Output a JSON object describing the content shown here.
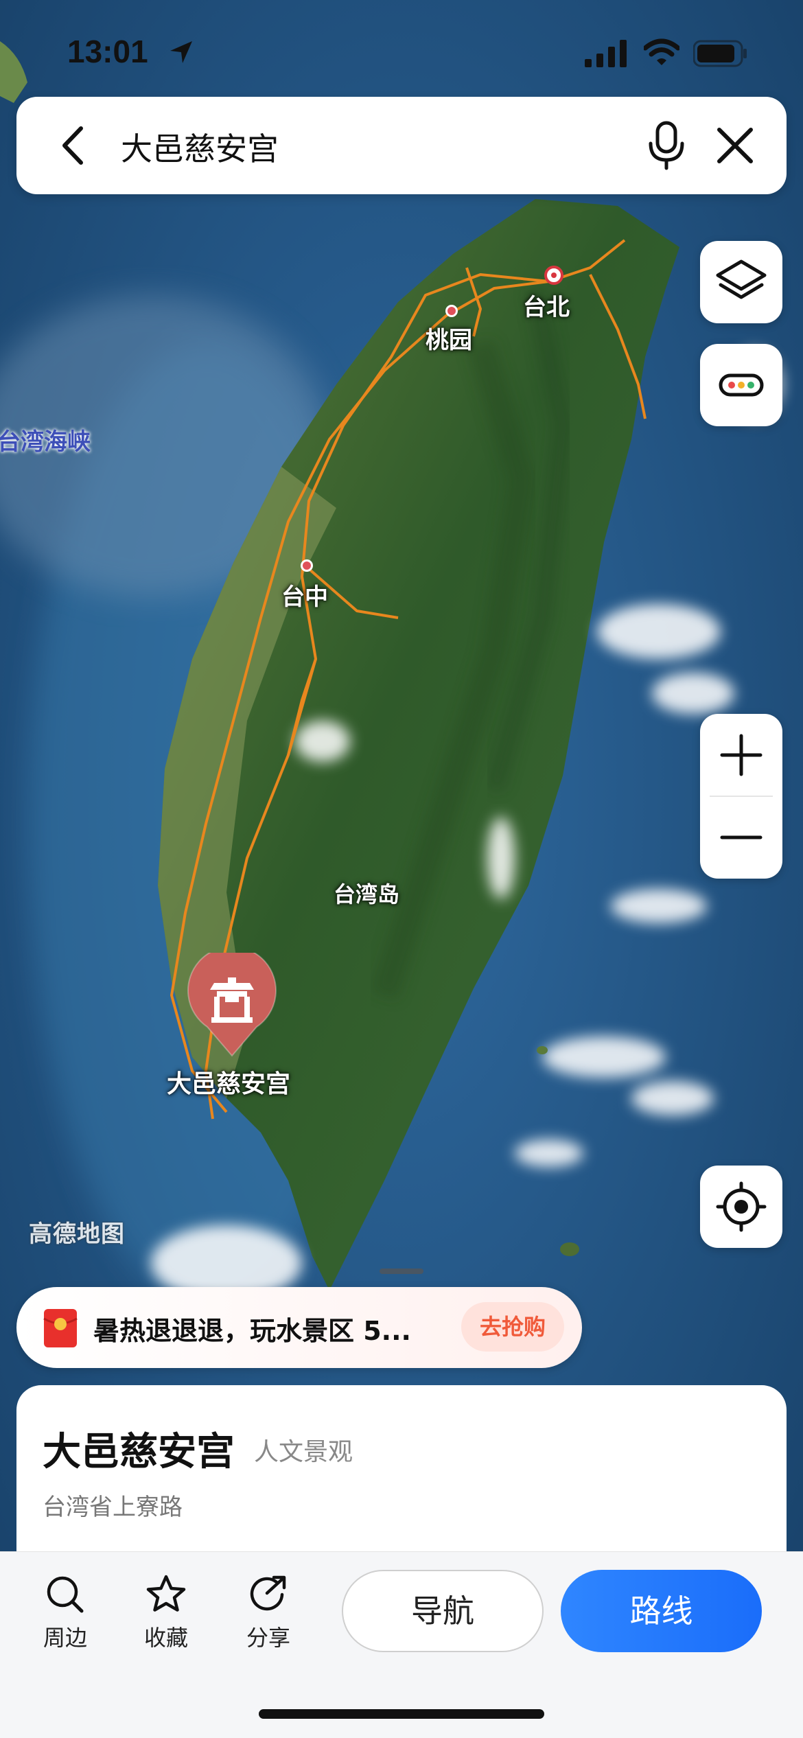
{
  "status_bar": {
    "time": "13:01",
    "icons": [
      "location-arrow-icon",
      "cellular-signal-icon",
      "wifi-icon",
      "battery-icon"
    ]
  },
  "search": {
    "query": "大邑慈安宫",
    "icons": [
      "back-arrow-icon",
      "microphone-icon",
      "close-icon"
    ]
  },
  "map": {
    "mode": "satellite",
    "labels": {
      "taipei": "台北",
      "taoyuan": "桃园",
      "taichung": "台中",
      "strait": "台湾海峡",
      "island": "台湾岛"
    },
    "poi_label": "大邑慈安宫",
    "watermark": "高德地图",
    "controls": [
      "layers-icon",
      "toolbox-icon",
      "zoom-in-icon",
      "zoom-out-icon",
      "locate-icon"
    ]
  },
  "promo": {
    "text": "暑热退退退，玩水景区 5...",
    "button": "去抢购",
    "icon": "red-envelope-icon"
  },
  "place": {
    "name": "大邑慈安宫",
    "category": "人文景观",
    "address": "台湾省上寮路"
  },
  "actions": {
    "nearby": "周边",
    "favorite": "收藏",
    "share": "分享",
    "navigate": "导航",
    "route": "路线"
  },
  "colors": {
    "accent": "#1a6dfa",
    "promo_accent": "#f05a3a",
    "poi_pin": "#c9605a"
  }
}
